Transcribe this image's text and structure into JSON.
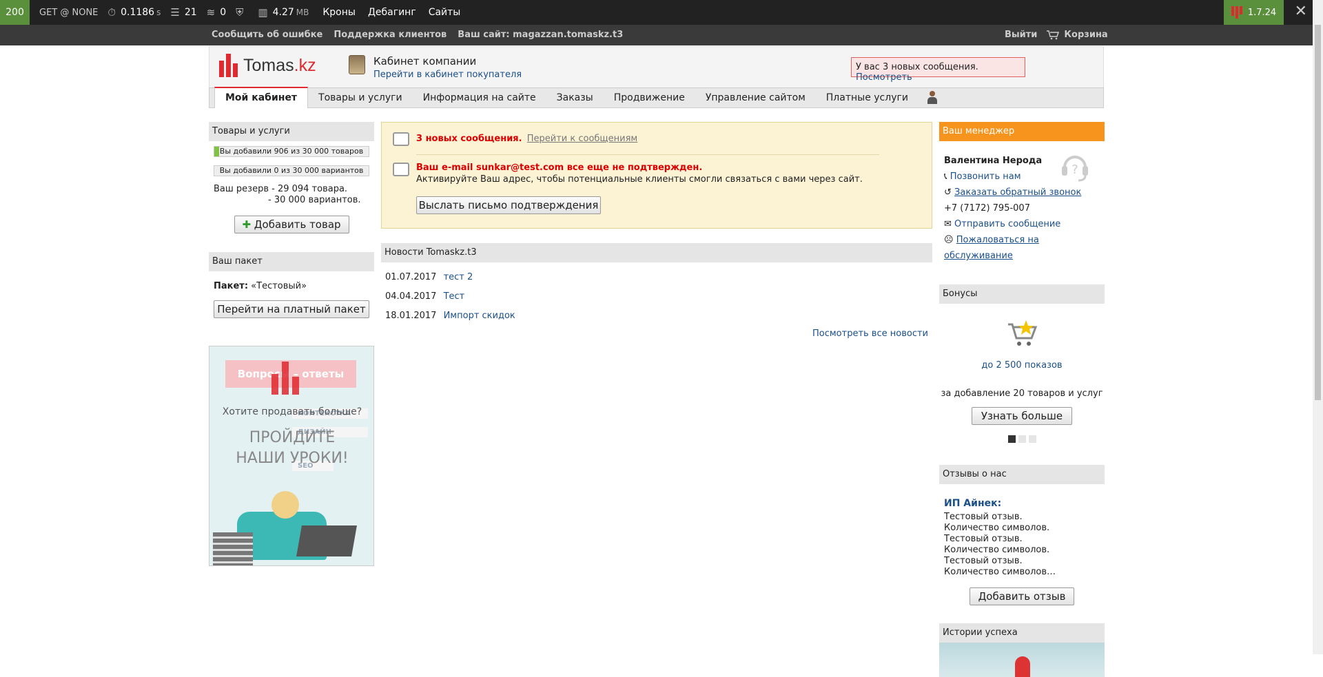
{
  "debugbar": {
    "status": "200",
    "method": "GET @ NONE",
    "time": "0.1186",
    "time_unit": "s",
    "queries": "21",
    "events": "0",
    "memory": "4.27",
    "memory_unit": "MB",
    "links": [
      "Кроны",
      "Дебагинг",
      "Сайты"
    ],
    "version": "1.7.24",
    "close": "✕"
  },
  "topmenu": {
    "report": "Сообщить об ошибке",
    "support": "Поддержка клиентов",
    "site": "Ваш сайт: magazzan.tomaskz.t3",
    "logout": "Выйти",
    "cart": "Корзина"
  },
  "header": {
    "logo_text": "Tomas",
    "logo_suffix": ".kz",
    "cabinet_title": "Кабинет компании",
    "cabinet_link": "Перейти в кабинет покупателя",
    "messages_text": "У вас 3 новых сообщения.",
    "messages_link": "Посмотреть"
  },
  "tabs": [
    "Мой кабинет",
    "Товары и услуги",
    "Информация на сайте",
    "Заказы",
    "Продвижение",
    "Управление сайтом",
    "Платные услуги"
  ],
  "left": {
    "goods_title": "Товары и услуги",
    "goods_bar": {
      "label": "Вы добавили 906 из 30 000 товаров",
      "fraction": 0.0302
    },
    "variants_bar": {
      "label": "Вы добавили 0 из 30 000 вариантов",
      "fraction": 0
    },
    "reserve1": "Ваш резерв - 29 094 товара.",
    "reserve2": "- 30 000 вариантов.",
    "add_button": "Добавить товар",
    "package_title": "Ваш пакет",
    "package_label": "Пакет:",
    "package_value": "«Тестовый»",
    "package_button": "Перейти на платный пакет",
    "ad": {
      "tag": "Вопросы – ответы",
      "q": "Хотите продавать больше?",
      "cta1": "ПРОЙДИТЕ",
      "cta2": "НАШИ УРОКИ!",
      "sign1": "КОНТЕКСТКА",
      "sign2": "ДИЗАЙН",
      "sign3": "SEO"
    }
  },
  "center": {
    "msg1_bold": "3 новых сообщения.",
    "msg1_link": "Перейти к сообщениям",
    "msg2_bold": "Ваш e-mail sunkar@test.com все еще не подтвержден.",
    "msg2_text": "Активируйте Ваш адрес, чтобы потенциальные клиенты смогли связаться с вами через сайт.",
    "confirm_button": "Выслать письмо подтверждения",
    "news_title": "Новости Tomaskz.t3",
    "news": [
      {
        "date": "01.07.2017",
        "title": "тест 2"
      },
      {
        "date": "04.04.2017",
        "title": "Тест"
      },
      {
        "date": "18.01.2017",
        "title": "Импорт скидок"
      }
    ],
    "all_news": "Посмотреть все новости"
  },
  "right": {
    "manager_title": "Ваш менеджер",
    "manager_name": "Валентина Нерода",
    "call": "Позвонить нам",
    "callback": "Заказать обратный звонок",
    "phone": "+7 (7172) 795-007",
    "send": "Отправить сообщение",
    "complain": "Пожаловаться на обслуживание",
    "bonus_title": "Бонусы",
    "bonus_link": "до 2 500 показов",
    "bonus_text": "за добавление 20 товаров и услуг",
    "bonus_button": "Узнать больше",
    "reviews_title": "Отзывы о нас",
    "review_author": "ИП Айнек:",
    "review_text": "Тестовый отзыв. Количество символов. Тестовый отзыв. Количество символов. Тестовый отзыв. Количество символов…",
    "review_button": "Добавить отзыв",
    "stories_title": "Истории успеха"
  },
  "colors": {
    "accent": "#e0282e",
    "manager_header": "#f7941d",
    "debug_green": "#5a8f3c",
    "link": "#1a4f8a"
  }
}
